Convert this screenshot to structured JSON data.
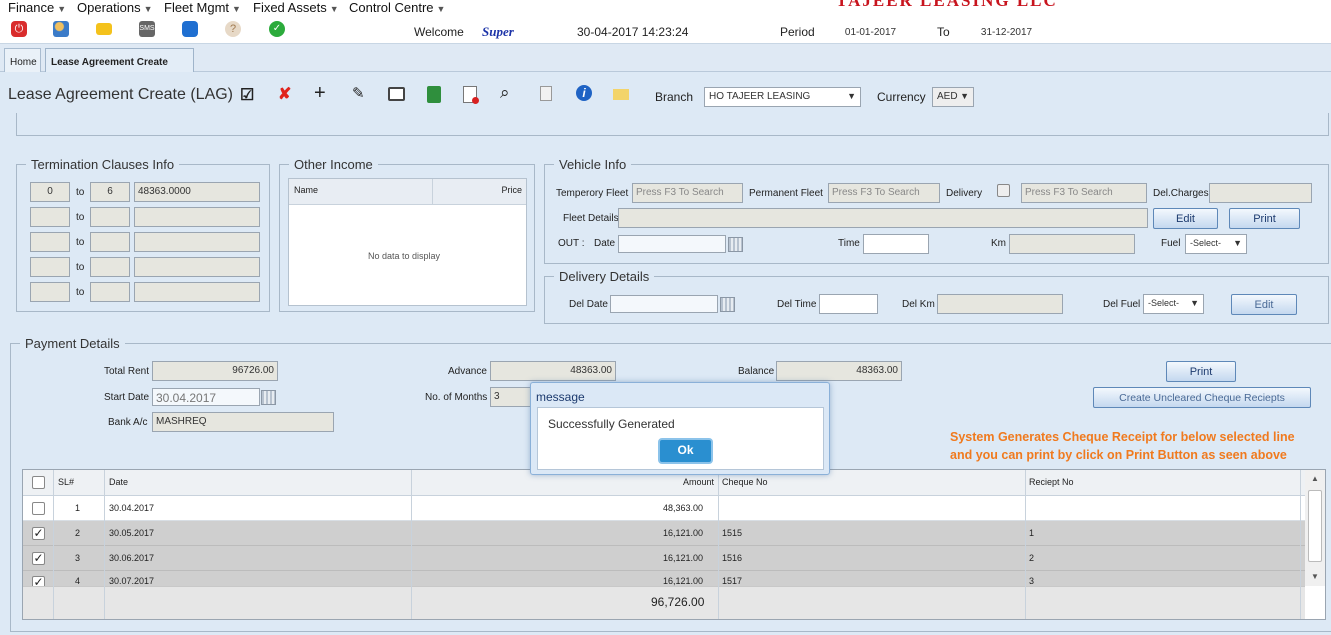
{
  "menu": {
    "items": [
      "Finance",
      "Operations",
      "Fleet Mgmt",
      "Fixed Assets",
      "Control Centre"
    ],
    "brand": "TAJEER LEASING LLC"
  },
  "toolbar": {
    "welcome_label": "Welcome",
    "user": "Super",
    "datetime": "30-04-2017 14:23:24",
    "period_label": "Period",
    "period_from": "01-01-2017",
    "to_label": "To",
    "period_to": "31-12-2017",
    "icons": [
      "power-icon",
      "users-icon",
      "mail-icon",
      "sms-icon",
      "chat-icon",
      "help-icon",
      "check-icon"
    ]
  },
  "tabs": [
    "Home",
    "Lease Agreement Create"
  ],
  "header": {
    "title": "Lease Agreement Create (LAG)",
    "branch_label": "Branch",
    "branch_value": "HO TAJEER LEASING",
    "currency_label": "Currency",
    "currency_value": "AED"
  },
  "termination": {
    "legend": "Termination Clauses Info",
    "to_label": "to",
    "rows": [
      {
        "from": "0",
        "to": "6",
        "amount": "48363.0000"
      },
      {
        "from": "",
        "to": "",
        "amount": ""
      },
      {
        "from": "",
        "to": "",
        "amount": ""
      },
      {
        "from": "",
        "to": "",
        "amount": ""
      },
      {
        "from": "",
        "to": "",
        "amount": ""
      }
    ]
  },
  "other_income": {
    "legend": "Other Income",
    "col_name": "Name",
    "col_price": "Price",
    "empty": "No data to display"
  },
  "vehicle": {
    "legend": "Vehicle Info",
    "temp_fleet_label": "Temperory Fleet",
    "perm_fleet_label": "Permanent Fleet",
    "delivery_label": "Delivery",
    "delcharges_label": "Del.Charges",
    "search_placeholder": "Press F3 To Search",
    "fleet_details_label": "Fleet Details",
    "edit_label": "Edit",
    "print_label": "Print",
    "out_label": "OUT :",
    "date_label": "Date",
    "time_label": "Time",
    "km_label": "Km",
    "fuel_label": "Fuel",
    "fuel_value": "-Select-"
  },
  "delivery": {
    "legend": "Delivery Details",
    "date_label": "Del Date",
    "time_label": "Del Time",
    "km_label": "Del Km",
    "fuel_label": "Del Fuel",
    "fuel_value": "-Select-",
    "edit_label": "Edit"
  },
  "payment": {
    "legend": "Payment Details",
    "total_rent_label": "Total Rent",
    "total_rent": "96726.00",
    "advance_label": "Advance",
    "advance": "48363.00",
    "balance_label": "Balance",
    "balance": "48363.00",
    "start_date_label": "Start Date",
    "start_date": "30.04.2017",
    "months_label": "No. of Months",
    "months": "3",
    "bank_label": "Bank A/c",
    "bank": "MASHREQ",
    "print_label": "Print",
    "create_receipts_label": "Create Uncleared Cheque Reciepts"
  },
  "grid": {
    "headers": [
      "SL#",
      "Date",
      "Amount",
      "Cheque No",
      "Reciept No"
    ],
    "rows": [
      {
        "checked": false,
        "sl": "1",
        "date": "30.04.2017",
        "amount": "48,363.00",
        "cheque": "",
        "receipt": ""
      },
      {
        "checked": true,
        "sl": "2",
        "date": "30.05.2017",
        "amount": "16,121.00",
        "cheque": "1515",
        "receipt": "1"
      },
      {
        "checked": true,
        "sl": "3",
        "date": "30.06.2017",
        "amount": "16,121.00",
        "cheque": "1516",
        "receipt": "2"
      },
      {
        "checked": true,
        "sl": "4",
        "date": "30.07.2017",
        "amount": "16,121.00",
        "cheque": "1517",
        "receipt": "3"
      }
    ],
    "total": "96,726.00"
  },
  "dialog": {
    "title": "message",
    "message": "Successfully Generated",
    "ok_label": "Ok"
  },
  "note": {
    "line1": "System Generates Cheque Receipt for below selected line",
    "line2": "and you can print by click on Print Button as seen above"
  },
  "colors": {
    "brand": "#c8141e",
    "note": "#f07a1e",
    "dialog_ok": "#2a8fd0"
  }
}
